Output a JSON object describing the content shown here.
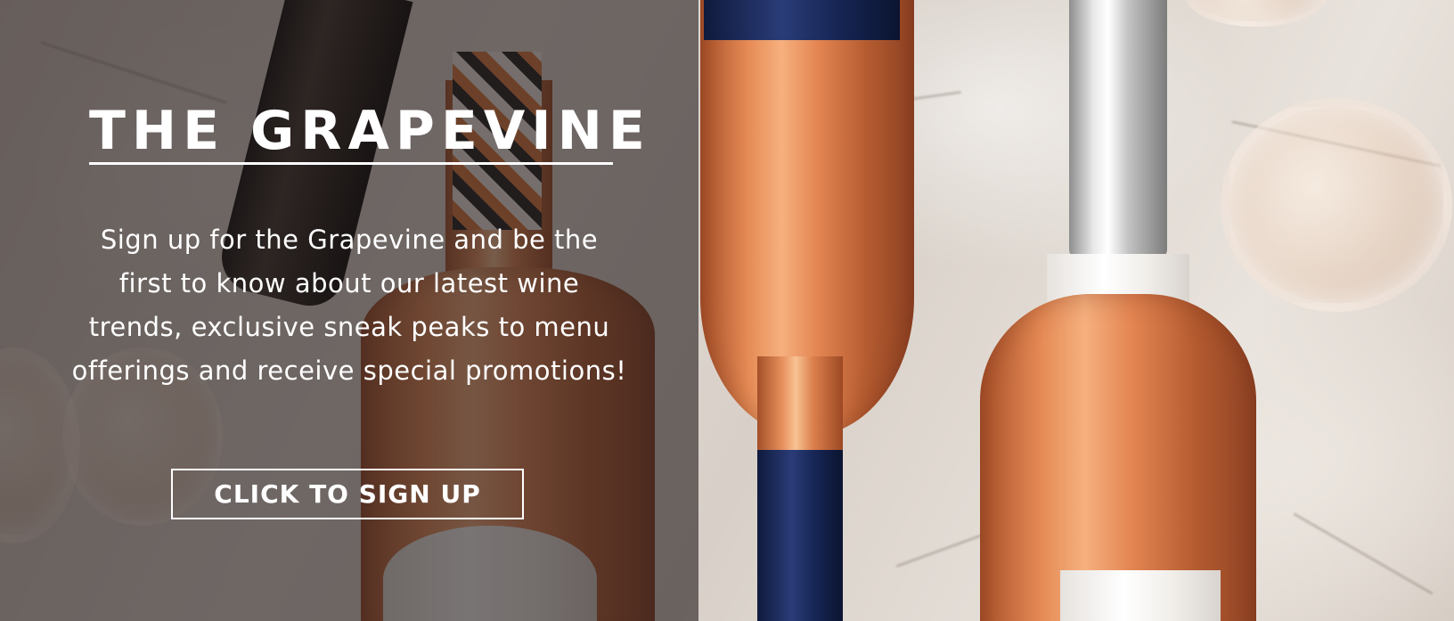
{
  "promo": {
    "title": "THE GRAPEVINE",
    "description": "Sign up for the Grapevine and be the first to know about our latest wine trends, exclusive sneak peaks to menu offerings and receive special promotions!",
    "button_label": "CLICK TO SIGN UP"
  },
  "colors": {
    "overlay": "#261e1e",
    "text": "#ffffff"
  }
}
